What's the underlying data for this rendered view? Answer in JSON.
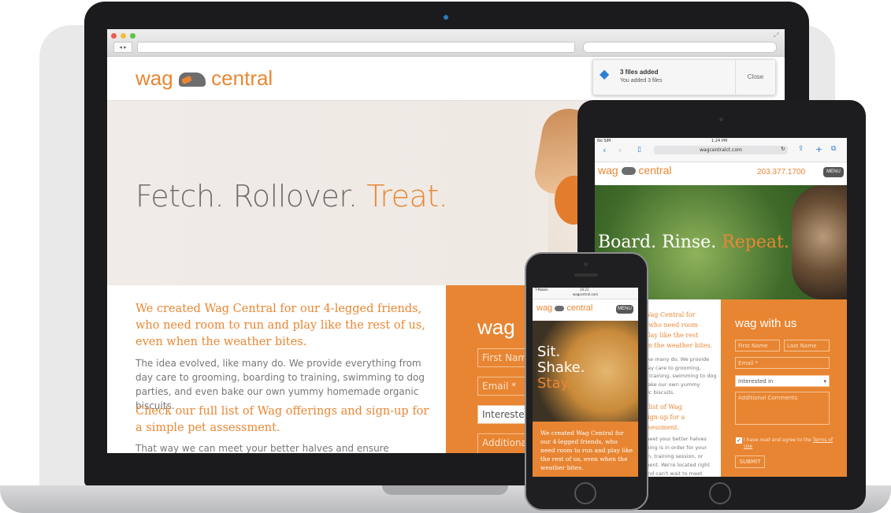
{
  "laptop": {
    "notification": {
      "title": "3 files added",
      "subtitle": "You added 3 files",
      "close_label": "Close"
    },
    "site": {
      "logo_left": "wag",
      "logo_right": "central",
      "hero": {
        "part1": "Fetch. Rollover.",
        "part2": "Treat."
      },
      "lead1": "We created Wag Central for our 4-legged friends, who need room to run and play like the rest of us, even when the weather bites.",
      "body1": "The idea evolved, like many do. We provide everything from day care to grooming, boarding to training, swimming to dog parties, and even bake our own yummy homemade organic biscuits.",
      "lead2": "Check our full list of Wag offerings and sign-up for a simple pet assessment.",
      "body2": "That way we can meet your better halves and ensure everything is",
      "panel_heading": "wag",
      "form": {
        "first_name": "First Nam",
        "email": "Email *",
        "interested": "Interested",
        "additional": "Additional"
      }
    }
  },
  "tablet": {
    "status": {
      "carrier": "No SIM",
      "time": "1:24 PM"
    },
    "url": "wagcentralct.com",
    "logo_left": "wag",
    "logo_right": "central",
    "phone": "203.377.1700",
    "menu_label": "MENU",
    "hero": {
      "part1": "Board. Rinse.",
      "part2": "Repeat."
    },
    "lead_lines": [
      "Wag Central for",
      ", who need room",
      "play like the rest",
      "en the weather bites."
    ],
    "body_lines": [
      "like many do. We provide",
      "day care to grooming,",
      "o training, swimming to dog",
      "bake our own yummy",
      "nic biscuits."
    ],
    "lead2_lines": [
      "l list of Wag",
      " sign-up for a",
      "ssessment."
    ],
    "body2_lines": [
      "meet your better halves",
      "thing is in order for your",
      "im, training session, or",
      "ment. We're located right",
      "and can't wait to meet"
    ],
    "form": {
      "heading": "wag with us",
      "first_name": "First Name",
      "last_name": "Last Name",
      "email": "Email *",
      "interested": "Interested in",
      "comments": "Additional Comments",
      "terms_prefix": "I have read and agree to the ",
      "terms_link": "Terms of Use",
      "submit": "SUBMIT"
    }
  },
  "phone": {
    "status": {
      "carrier": "T-Mobile",
      "time": "10:21"
    },
    "url": "wagcentral.com",
    "logo_left": "wag",
    "logo_right": "central",
    "menu_label": "MENU",
    "hero": {
      "line1": "Sit.",
      "line2": "Shake.",
      "line3": "Stay."
    },
    "lead": "We created Wag Central for our 4-legged friends, who need room to run and play like the rest of us, even when the weather bites."
  },
  "colors": {
    "accent": "#e98733",
    "panel": "#e88532",
    "text_gray": "#777777"
  }
}
